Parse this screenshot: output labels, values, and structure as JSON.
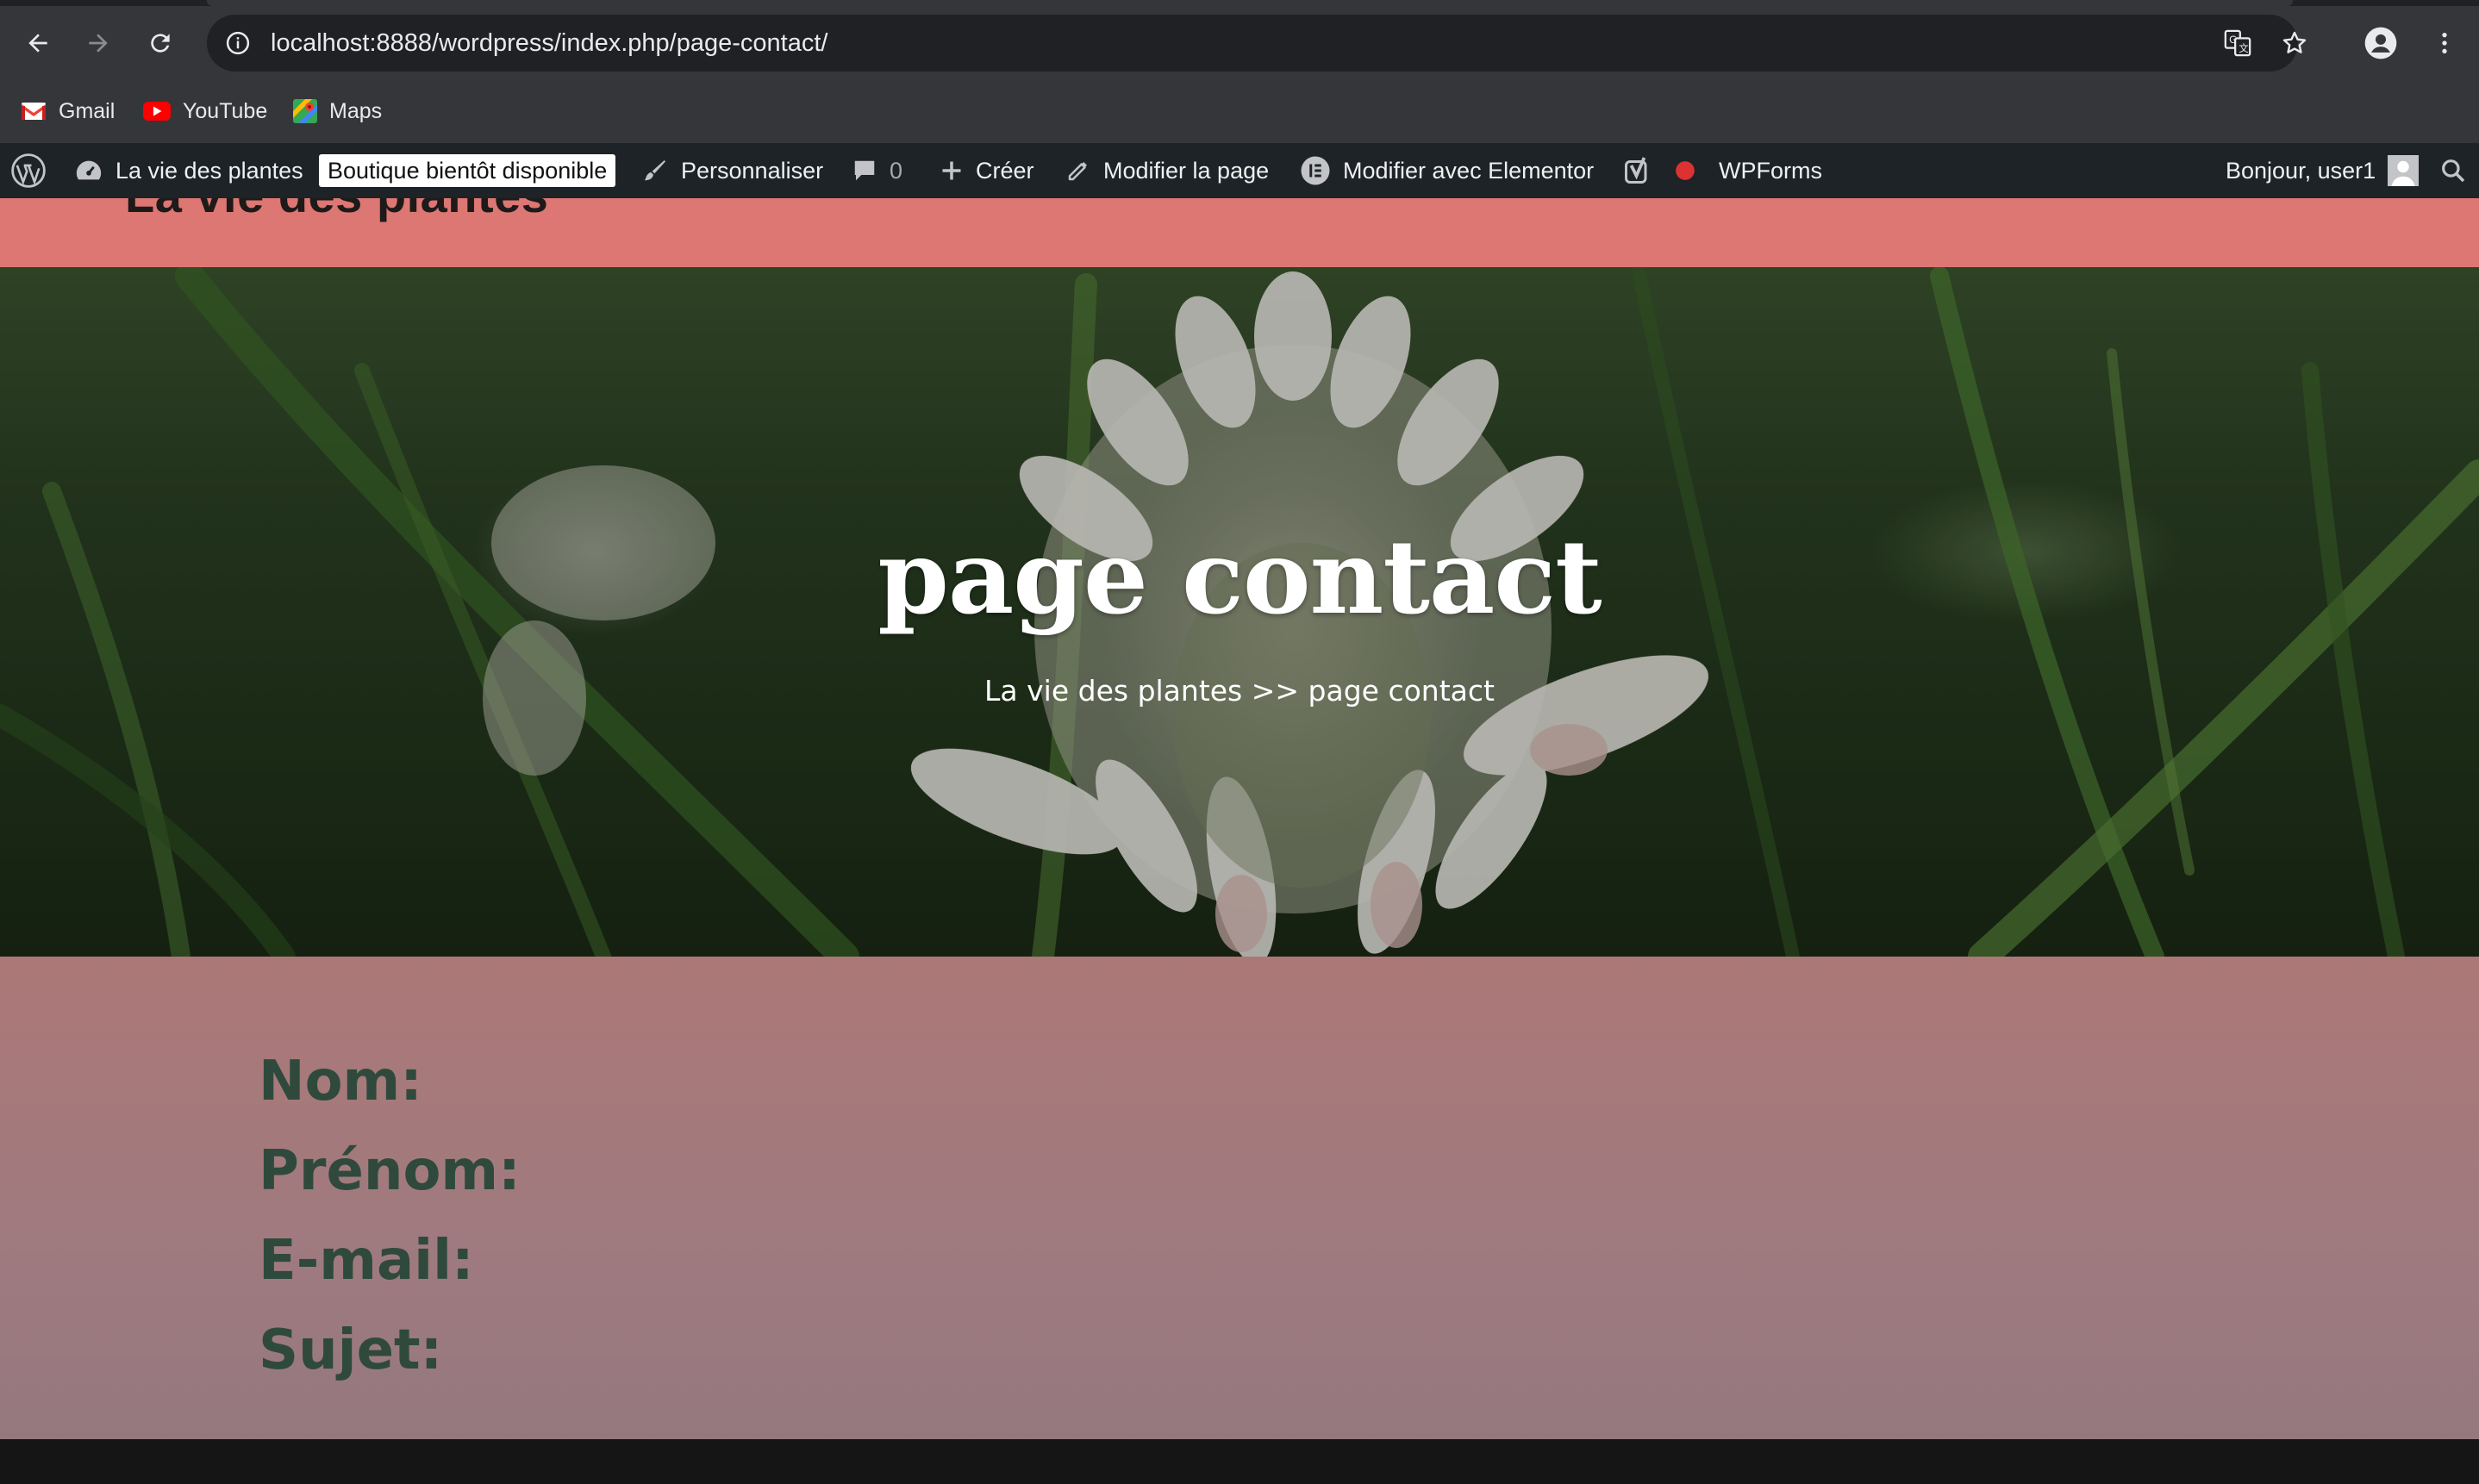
{
  "browser": {
    "url": "localhost:8888/wordpress/index.php/page-contact/",
    "bookmarks": [
      {
        "label": "Gmail",
        "icon": "gmail-icon"
      },
      {
        "label": "YouTube",
        "icon": "youtube-icon"
      },
      {
        "label": "Maps",
        "icon": "maps-icon"
      }
    ]
  },
  "adminbar": {
    "site_name": "La vie des plantes",
    "badge": "Boutique bientôt disponible",
    "customize": "Personnaliser",
    "comments_count": "0",
    "new": "Créer",
    "edit_page": "Modifier la page",
    "elementor": "Modifier avec Elementor",
    "wpforms": "WPForms",
    "greeting": "Bonjour, user1"
  },
  "page": {
    "site_title": "La vie des plantes",
    "hero_title": "page contact",
    "breadcrumb": "La vie des plantes >> page contact",
    "form": {
      "labels": [
        "Nom:",
        "Prénom:",
        "E-mail:",
        "Sujet:"
      ]
    }
  },
  "colors": {
    "header_bg": "#dd7773",
    "form_bg": "#ac7877",
    "label_color": "#2f4a3c",
    "adminbar_bg": "#1d2327"
  }
}
